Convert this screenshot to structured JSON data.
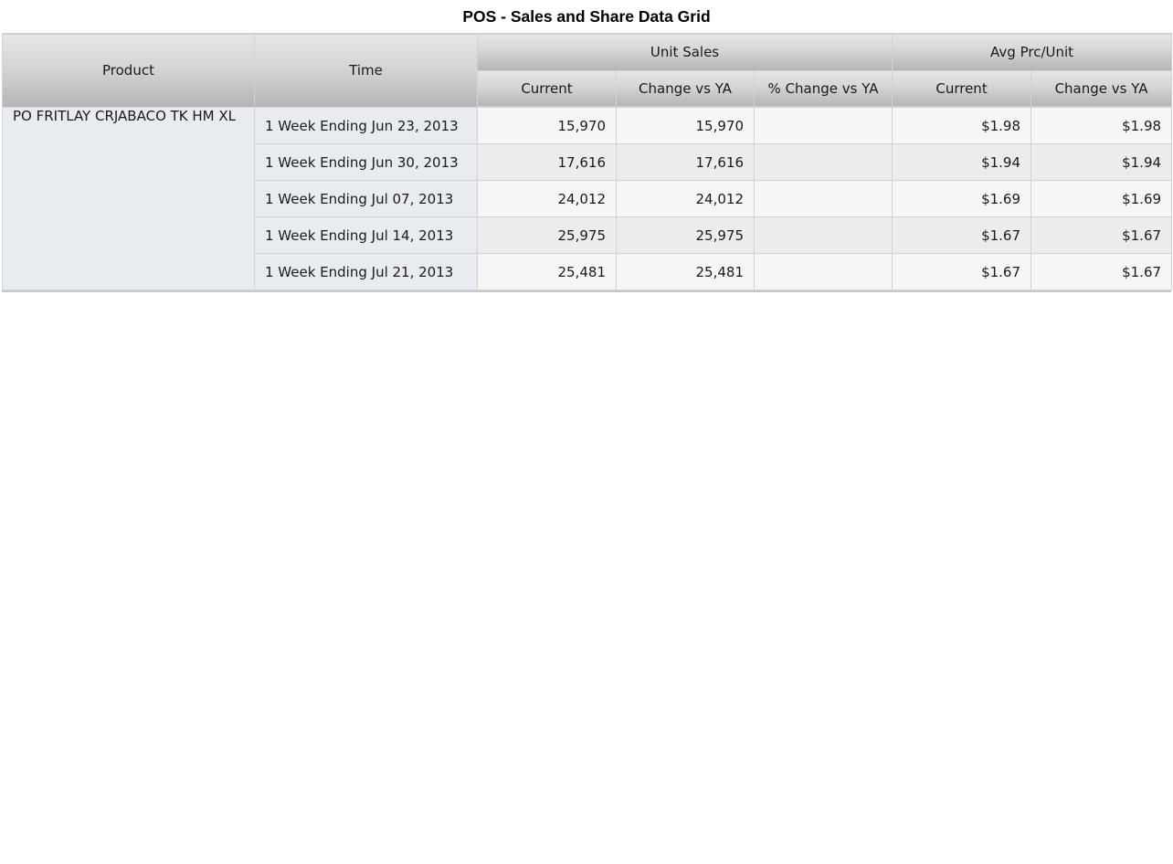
{
  "title": "POS - Sales and Share Data Grid",
  "headers": {
    "product": "Product",
    "time": "Time",
    "unit_sales": "Unit Sales",
    "avg_prc_unit": "Avg Prc/Unit",
    "unit_sales_sub": [
      "Current",
      "Change vs YA",
      "% Change vs YA"
    ],
    "avg_prc_sub": [
      "Current",
      "Change vs YA"
    ]
  },
  "product": "PO FRITLAY CRJABACO TK HM XL",
  "rows": [
    {
      "time": "1 Week Ending Jun 23, 2013",
      "us_current": "15,970",
      "us_change": "15,970",
      "us_pct_change": "",
      "ap_current": "$1.98",
      "ap_change": "$1.98"
    },
    {
      "time": "1 Week Ending Jun 30, 2013",
      "us_current": "17,616",
      "us_change": "17,616",
      "us_pct_change": "",
      "ap_current": "$1.94",
      "ap_change": "$1.94"
    },
    {
      "time": "1 Week Ending Jul 07, 2013",
      "us_current": "24,012",
      "us_change": "24,012",
      "us_pct_change": "",
      "ap_current": "$1.69",
      "ap_change": "$1.69"
    },
    {
      "time": "1 Week Ending Jul 14, 2013",
      "us_current": "25,975",
      "us_change": "25,975",
      "us_pct_change": "",
      "ap_current": "$1.67",
      "ap_change": "$1.67"
    },
    {
      "time": "1 Week Ending Jul 21, 2013",
      "us_current": "25,481",
      "us_change": "25,481",
      "us_pct_change": "",
      "ap_current": "$1.67",
      "ap_change": "$1.67"
    }
  ]
}
